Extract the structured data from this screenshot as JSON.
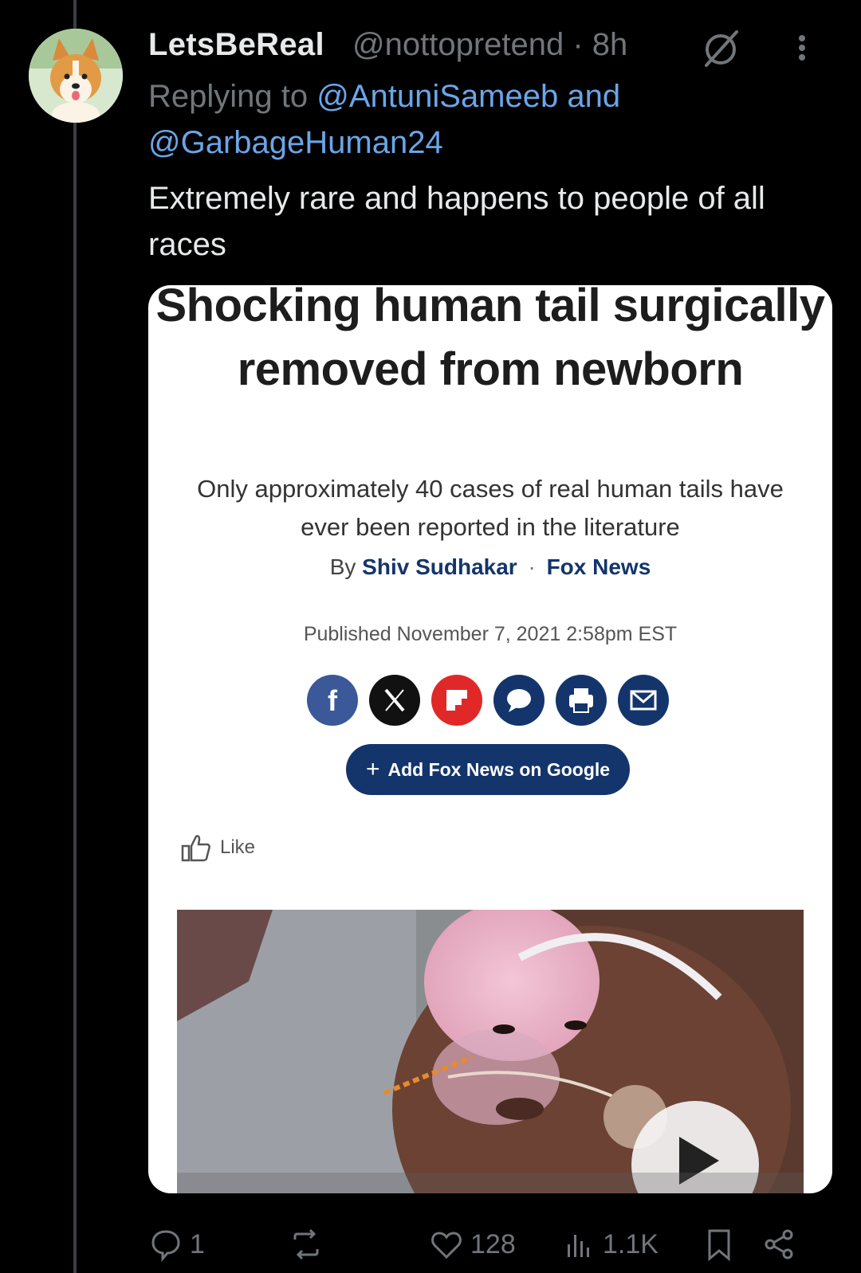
{
  "tweet": {
    "display_name": "LetsBeReal",
    "handle_time": "@nottopretend · 8h",
    "replying_prefix": "Replying to ",
    "mention_1": "@AntuniSameeb",
    "and_word": " and",
    "mention_2": "@GarbageHuman24",
    "text": "Extremely rare and happens to people of all races"
  },
  "article": {
    "headline": "Shocking human tail surgically removed from newborn",
    "subhead": "Only approximately 40 cases of real human tails have ever been reported in the literature",
    "by_prefix": "By",
    "author": "Shiv Sudhakar",
    "separator": "·",
    "outlet": "Fox News",
    "published": "Published November 7, 2021 2:58pm EST",
    "google_button": "Add Fox News on Google",
    "google_plus": "+",
    "like_label": "Like",
    "share_icons": [
      "facebook-icon",
      "x-icon",
      "flipboard-icon",
      "comment-icon",
      "print-icon",
      "email-icon"
    ]
  },
  "actions": {
    "replies": "1",
    "reposts": "",
    "likes": "128",
    "views": "1.1K"
  },
  "colors": {
    "background": "#000000",
    "link": "#1d9bf0",
    "muted": "#71767b",
    "fox_navy": "#13356b"
  }
}
